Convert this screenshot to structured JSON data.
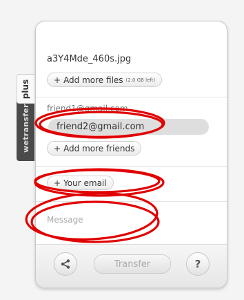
{
  "side_tabs": {
    "plus": "plus",
    "wetransfer": "wetransfer"
  },
  "files": {
    "filename": "a3Y4Mde_460s.jpg",
    "add_button_label": "Add more files",
    "space_left": "(2.0 GB left)"
  },
  "friends": {
    "emails": [
      "friend1@gmail.com",
      "friend2@gmail.com"
    ],
    "add_button_label": "Add more friends"
  },
  "your_email": {
    "label": "Your email"
  },
  "message": {
    "placeholder": "Message"
  },
  "footer": {
    "share_icon": "share-icon",
    "transfer_label": "Transfer",
    "help_label": "?"
  },
  "annotation": {
    "color": "#e00000",
    "shape": "ellipse"
  }
}
